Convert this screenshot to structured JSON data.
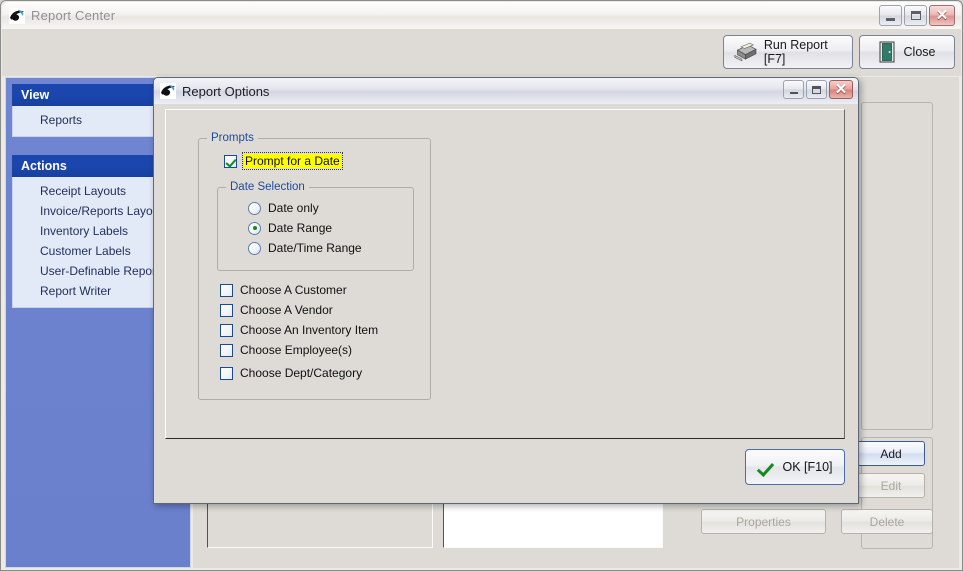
{
  "main_window": {
    "title": "Report Center",
    "icon": "app-logo-icon",
    "window_controls": {
      "minimize": "minimize-icon",
      "maximize": "maximize-icon",
      "close": "✕"
    },
    "toolbar": {
      "run_report_label": "Run Report [F7]",
      "run_report_icon": "printer-icon",
      "close_label": "Close",
      "close_icon": "exit-door-icon"
    }
  },
  "sidebar": {
    "groups": [
      {
        "header": "View",
        "collapse_icon": "chevron-up-double-icon",
        "items": [
          {
            "label": "Reports"
          }
        ]
      },
      {
        "header": "Actions",
        "collapse_icon": "chevron-up-double-icon",
        "items": [
          {
            "label": "Receipt Layouts"
          },
          {
            "label": "Invoice/Reports Layouts"
          },
          {
            "label": "Inventory Labels"
          },
          {
            "label": "Customer Labels"
          },
          {
            "label": "User-Definable Reports"
          },
          {
            "label": "Report Writer"
          }
        ]
      }
    ]
  },
  "background_content": {
    "buttons": [
      {
        "label": "Add",
        "enabled": true
      },
      {
        "label": "Edit",
        "enabled": false
      },
      {
        "label": "Properties",
        "enabled": false
      },
      {
        "label": "Delete",
        "enabled": false
      }
    ]
  },
  "dialog": {
    "title": "Report Options",
    "icon": "app-logo-icon",
    "window_controls": {
      "minimize": "minimize-icon",
      "maximize": "maximize-icon",
      "close": "✕"
    },
    "prompts_group": {
      "legend": "Prompts",
      "prompt_for_date": {
        "label": "Prompt for a Date",
        "checked": true,
        "highlighted": true
      },
      "date_selection_group": {
        "legend": "Date Selection",
        "options": [
          {
            "label": "Date only",
            "selected": false
          },
          {
            "label": "Date Range",
            "selected": true
          },
          {
            "label": "Date/Time Range",
            "selected": false
          }
        ]
      },
      "checkboxes": [
        {
          "label": "Choose A Customer",
          "checked": false
        },
        {
          "label": "Choose A Vendor",
          "checked": false
        },
        {
          "label": "Choose An Inventory Item",
          "checked": false
        },
        {
          "label": "Choose Employee(s)",
          "checked": false
        },
        {
          "label": "Choose Dept/Category",
          "checked": false
        }
      ]
    },
    "ok_button": {
      "label": "OK [F10]",
      "icon": "green-check-icon"
    }
  },
  "colors": {
    "sidebar_header": "#1b46ad",
    "sidebar_body": "#6d82ce",
    "highlight_yellow": "#ffff00",
    "check_green": "#0d8a22",
    "window_chrome": "#dedbd6"
  }
}
